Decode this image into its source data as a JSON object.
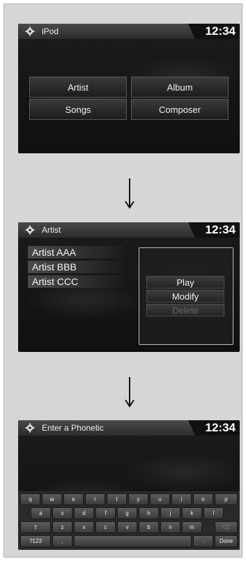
{
  "screen1": {
    "title": "iPod",
    "clock": "12:34",
    "buttons": [
      "Artist",
      "Album",
      "Songs",
      "Composer"
    ]
  },
  "screen2": {
    "title": "Artist",
    "clock": "12:34",
    "list": [
      "Artist AAA",
      "Artist BBB",
      "Artist CCC"
    ],
    "popup": {
      "play": "Play",
      "modify": "Modify",
      "delete": "Delete"
    }
  },
  "screen3": {
    "title": "Enter a Phonetic",
    "clock": "12:34",
    "keyboard": {
      "row1": [
        "q",
        "w",
        "e",
        "r",
        "t",
        "y",
        "u",
        "i",
        "o",
        "p"
      ],
      "row2": [
        "a",
        "s",
        "d",
        "f",
        "g",
        "h",
        "j",
        "k",
        "l"
      ],
      "row3": [
        "z",
        "x",
        "c",
        "v",
        "b",
        "n",
        "m"
      ],
      "shift": "⇧",
      "backspace": "⌫",
      "mode": "?123",
      "comma": ",",
      "period": ".",
      "done": "Done"
    }
  },
  "icons": {
    "settings": "gear-icon",
    "arrow": "down-arrow-icon"
  }
}
